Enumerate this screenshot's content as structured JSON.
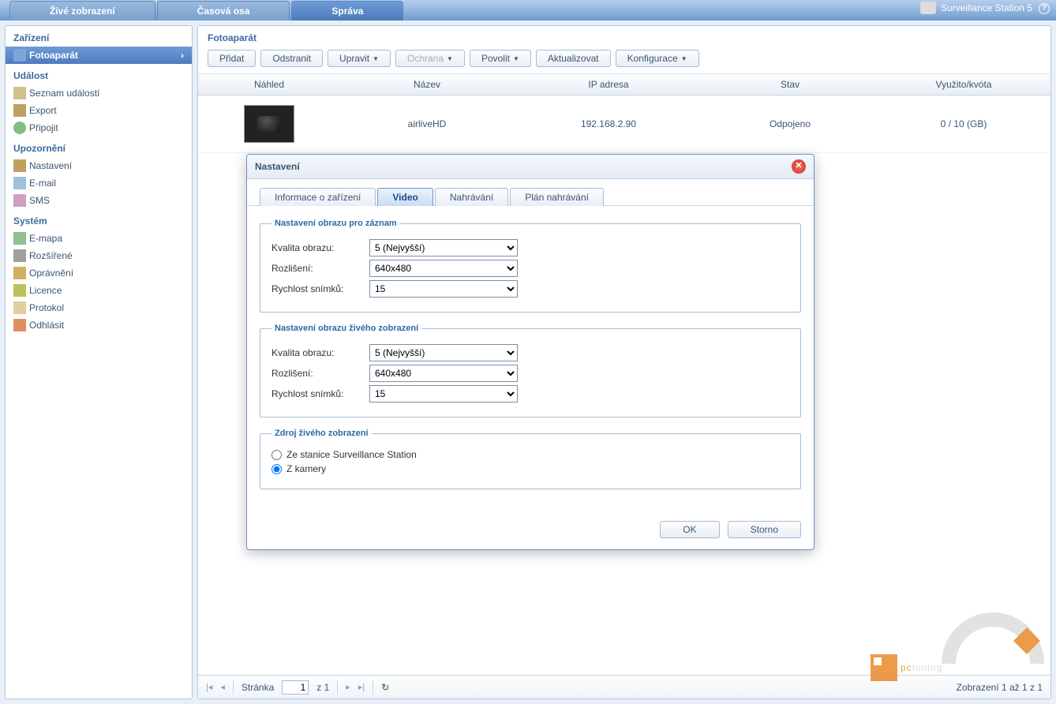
{
  "app": {
    "title": "Surveillance Station 5"
  },
  "topTabs": [
    "Živé zobrazení",
    "Časová osa",
    "Správa"
  ],
  "topActiveIdx": 2,
  "sidebar": {
    "groups": [
      {
        "title": "Zařízení",
        "items": [
          {
            "label": "Fotoaparát",
            "icon": "ic-cam",
            "selected": true
          }
        ]
      },
      {
        "title": "Událost",
        "items": [
          {
            "label": "Seznam událostí",
            "icon": "ic-list"
          },
          {
            "label": "Export",
            "icon": "ic-export"
          },
          {
            "label": "Připojit",
            "icon": "ic-connect"
          }
        ]
      },
      {
        "title": "Upozornění",
        "items": [
          {
            "label": "Nastavení",
            "icon": "ic-settings"
          },
          {
            "label": "E-mail",
            "icon": "ic-email"
          },
          {
            "label": "SMS",
            "icon": "ic-sms"
          }
        ]
      },
      {
        "title": "Systém",
        "items": [
          {
            "label": "E-mapa",
            "icon": "ic-map"
          },
          {
            "label": "Rozšířené",
            "icon": "ic-ext"
          },
          {
            "label": "Oprávnění",
            "icon": "ic-perm"
          },
          {
            "label": "Licence",
            "icon": "ic-lic"
          },
          {
            "label": "Protokol",
            "icon": "ic-log"
          },
          {
            "label": "Odhlásit",
            "icon": "ic-logout"
          }
        ]
      }
    ]
  },
  "content": {
    "title": "Fotoaparát",
    "toolbar": [
      {
        "label": "Přidat",
        "dropdown": false
      },
      {
        "label": "Odstranit",
        "dropdown": false
      },
      {
        "label": "Upravit",
        "dropdown": true
      },
      {
        "label": "Ochrana",
        "dropdown": true,
        "disabled": true
      },
      {
        "label": "Povolit",
        "dropdown": true
      },
      {
        "label": "Aktualizovat",
        "dropdown": false
      },
      {
        "label": "Konfigurace",
        "dropdown": true
      }
    ],
    "columns": {
      "preview": "Náhled",
      "name": "Název",
      "ip": "IP adresa",
      "status": "Stav",
      "usage": "Využito/kvóta"
    },
    "rows": [
      {
        "name": "airliveHD",
        "ip": "192.168.2.90",
        "status": "Odpojeno",
        "usage": "0 / 10 (GB)"
      }
    ]
  },
  "pager": {
    "label": "Stránka",
    "page": "1",
    "of": "z 1",
    "range": "Zobrazení 1 až 1 z 1"
  },
  "dialog": {
    "title": "Nastavení",
    "tabs": [
      "Informace o zařízení",
      "Video",
      "Nahrávání",
      "Plán nahrávání"
    ],
    "activeIdx": 1,
    "fs1": {
      "legend": "Nastavení obrazu pro záznam",
      "quality_label": "Kvalita obrazu:",
      "quality_value": "5 (Nejvyšší)",
      "res_label": "Rozlišení:",
      "res_value": "640x480",
      "fps_label": "Rychlost snímků:",
      "fps_value": "15"
    },
    "fs2": {
      "legend": "Nastavení obrazu živého zobrazení",
      "quality_label": "Kvalita obrazu:",
      "quality_value": "5 (Nejvyšší)",
      "res_label": "Rozlišení:",
      "res_value": "640x480",
      "fps_label": "Rychlost snímků:",
      "fps_value": "15"
    },
    "fs3": {
      "legend": "Zdroj živého zobrazení",
      "opt1": "Ze stanice Surveillance Station",
      "opt2": "Z kamery",
      "selected": "opt2"
    },
    "ok": "OK",
    "cancel": "Storno"
  },
  "watermark": {
    "t1": "pc",
    "t2": "tuning"
  }
}
